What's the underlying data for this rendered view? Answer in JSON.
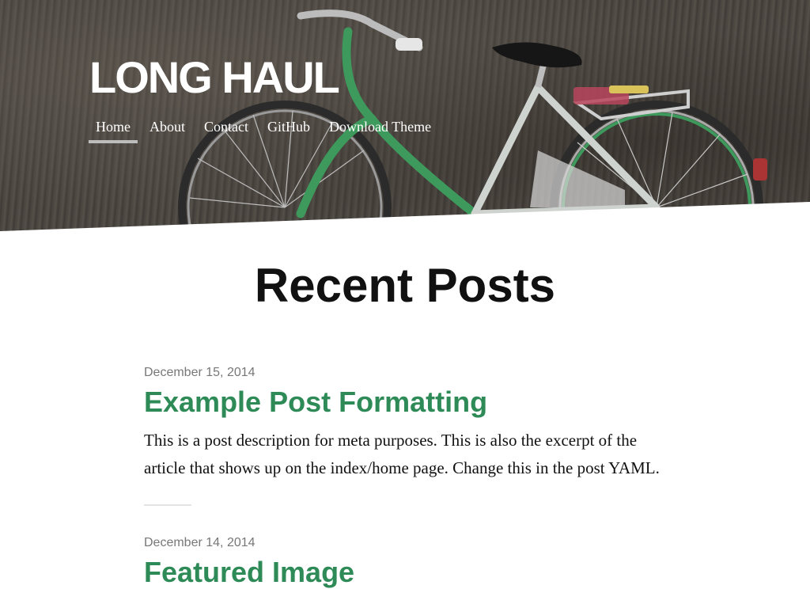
{
  "site": {
    "title": "LONG HAUL"
  },
  "nav": {
    "items": [
      {
        "label": "Home",
        "active": true
      },
      {
        "label": "About"
      },
      {
        "label": "Contact"
      },
      {
        "label": "GitHub"
      },
      {
        "label": "Download Theme"
      }
    ]
  },
  "main": {
    "heading": "Recent Posts",
    "posts": [
      {
        "date": "December 15, 2014",
        "title": "Example Post Formatting",
        "excerpt": "This is a post description for meta purposes. This is also the excerpt of the article that shows up on the index/home page. Change this in the post YAML."
      },
      {
        "date": "December 14, 2014",
        "title": "Featured Image"
      }
    ]
  },
  "colors": {
    "accent": "#2e8b57",
    "nav_underline": "#bdbdbd",
    "bike_frame": "#3e9a5c"
  }
}
